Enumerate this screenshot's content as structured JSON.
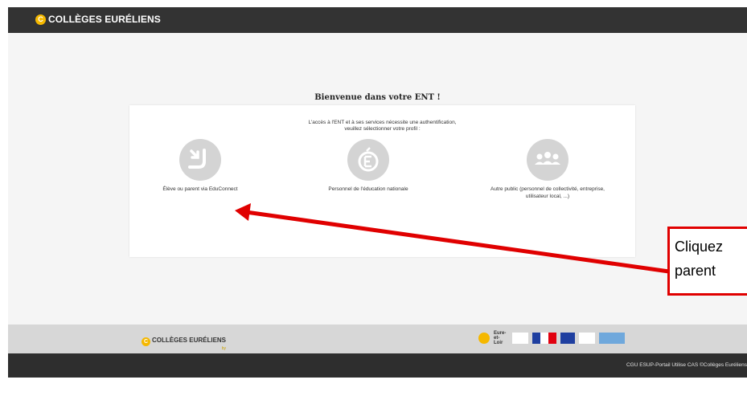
{
  "header": {
    "logo_badge": "C",
    "logo_text": "COLLÈGES EURÉLIENS"
  },
  "main": {
    "title": "Bienvenue dans votre ENT !",
    "intro_line1": "L'accès à l'ENT et à ses services nécessite une authentification,",
    "intro_line2": "veuillez sélectionner votre profil :",
    "profiles": [
      {
        "label": "Élève ou parent via EduConnect",
        "icon": "educonnect-icon"
      },
      {
        "label": "Personnel de l'éducation nationale",
        "icon": "education-nationale-icon"
      },
      {
        "label_line1": "Autre public (personnel de collectivité, entreprise,",
        "label_line2": "utilisateur local, ...)",
        "icon": "group-icon"
      }
    ]
  },
  "footer": {
    "logo_text": "COLLÈGES EURÉLIENS",
    "logo_sub": "by",
    "partner_text": "Eure-et-Loir",
    "links": "CGU ESUP-Portail Utilise CAS ©Collèges Euréliens"
  },
  "annotation": {
    "line1": "Cliquez",
    "line2": "parent",
    "color": "#e00000"
  },
  "colors": {
    "brand_yellow": "#f5b800",
    "topbar": "#333333",
    "footer_dark": "#2e2e2e",
    "footer_gray": "#d7d7d7"
  }
}
